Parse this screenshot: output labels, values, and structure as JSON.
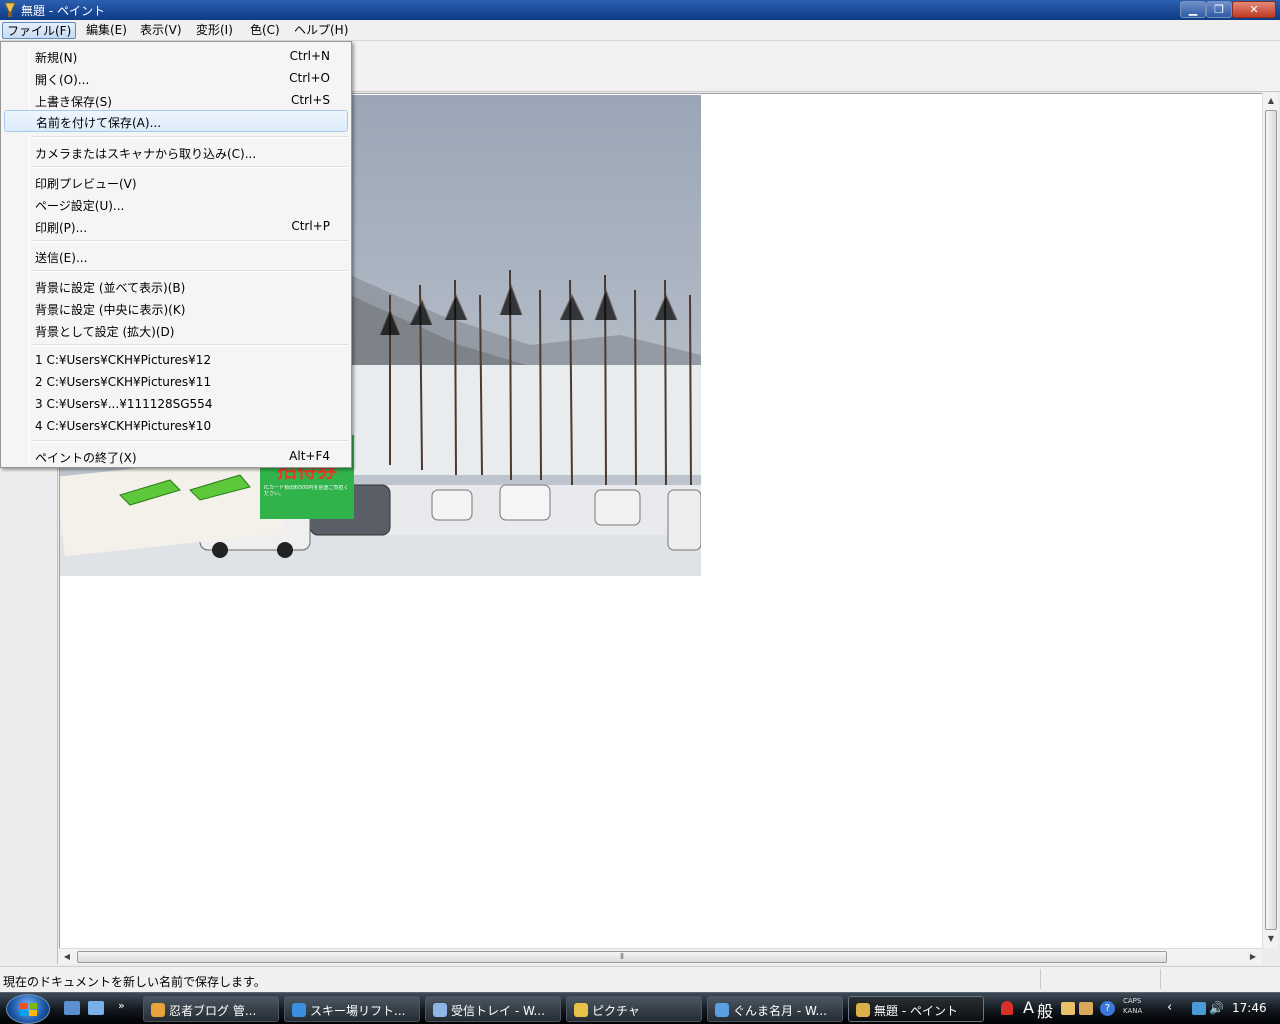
{
  "window": {
    "title": "無題 - ペイント",
    "controls": {
      "minimize": "▁",
      "maximize": "❐",
      "close": "✕"
    }
  },
  "menubar": {
    "items": [
      "ファイル(F)",
      "編集(E)",
      "表示(V)",
      "変形(I)",
      "色(C)",
      "ヘルプ(H)"
    ]
  },
  "file_menu": {
    "items": [
      {
        "label": "新規(N)",
        "shortcut": "Ctrl+N"
      },
      {
        "label": "開く(O)...",
        "shortcut": "Ctrl+O"
      },
      {
        "label": "上書き保存(S)",
        "shortcut": "Ctrl+S"
      },
      {
        "label": "名前を付けて保存(A)...",
        "shortcut": "",
        "highlighted": true
      },
      {
        "label": "カメラまたはスキャナから取り込み(C)...",
        "shortcut": ""
      },
      {
        "label": "印刷プレビュー(V)",
        "shortcut": ""
      },
      {
        "label": "ページ設定(U)...",
        "shortcut": ""
      },
      {
        "label": "印刷(P)...",
        "shortcut": "Ctrl+P"
      },
      {
        "label": "送信(E)...",
        "shortcut": ""
      },
      {
        "label": "背景に設定 (並べて表示)(B)",
        "shortcut": ""
      },
      {
        "label": "背景に設定 (中央に表示)(K)",
        "shortcut": ""
      },
      {
        "label": "背景として設定 (拡大)(D)",
        "shortcut": ""
      },
      {
        "label": "1 C:¥Users¥CKH¥Pictures¥12",
        "shortcut": ""
      },
      {
        "label": "2 C:¥Users¥CKH¥Pictures¥11",
        "shortcut": ""
      },
      {
        "label": "3 C:¥Users¥...¥111128SG554",
        "shortcut": ""
      },
      {
        "label": "4 C:¥Users¥CKH¥Pictures¥10",
        "shortcut": ""
      },
      {
        "label": "ペイントの終了(X)",
        "shortcut": "Alt+F4"
      }
    ]
  },
  "canvas": {
    "photo_sign_text": "招待券",
    "photo_sign_small": "ICカード預出料500円を別途ご負担ください。"
  },
  "statusbar": {
    "text": "現在のドキュメントを新しい名前で保存します。"
  },
  "taskbar": {
    "buttons": [
      {
        "label": "忍者ブログ 管...",
        "icon_color": "#e8a33c",
        "icon": "chrome-icon"
      },
      {
        "label": "スキー場リフト...",
        "icon_color": "#3b8fe0",
        "icon": "ie-icon"
      },
      {
        "label": "受信トレイ - W...",
        "icon_color": "#8fb6e6",
        "icon": "mail-icon"
      },
      {
        "label": "ピクチャ",
        "icon_color": "#e6c24a",
        "icon": "folder-icon"
      },
      {
        "label": "ぐんま名月 - W...",
        "icon_color": "#5aa0e0",
        "icon": "explorer-icon"
      },
      {
        "label": "無題 - ペイント",
        "icon_color": "#d9b04a",
        "icon": "paint-icon",
        "active": true
      }
    ],
    "ime_mode": "A",
    "ime_kanji": "般",
    "caps": "CAPS",
    "kana": "KANA",
    "clock": "17:46"
  },
  "colors": {
    "titlebar": "#1e4f9f",
    "menu_highlight": "#dcebfc",
    "taskbar": "#1a2128"
  }
}
